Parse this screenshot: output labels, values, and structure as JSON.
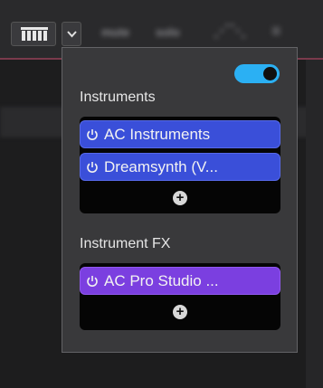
{
  "toolbar": {
    "keyboard_icon": "piano-keys-icon",
    "dropdown_icon": "chevron-down-icon",
    "blurred_labels": [
      "mute",
      "solo"
    ]
  },
  "popup": {
    "enabled": true,
    "instruments": {
      "title": "Instruments",
      "plugins": [
        {
          "name": "AC Instruments",
          "icon": "power-icon"
        },
        {
          "name": "Dreamsynth (V...",
          "icon": "power-icon"
        }
      ],
      "add_icon": "plus-icon"
    },
    "instrument_fx": {
      "title": "Instrument FX",
      "plugins": [
        {
          "name": "AC Pro Studio ...",
          "icon": "power-icon"
        }
      ],
      "add_icon": "plus-icon"
    },
    "colors": {
      "toggle_on": "#2bb0f3",
      "instrument_plugin": "#3a4fd9",
      "fx_plugin": "#7b3fe0"
    }
  }
}
